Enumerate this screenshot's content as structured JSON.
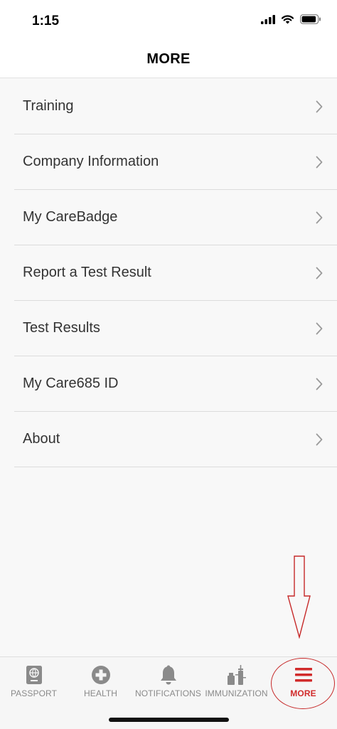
{
  "status_bar": {
    "time": "1:15"
  },
  "header": {
    "title": "MORE"
  },
  "menu": {
    "items": [
      {
        "label": "Training"
      },
      {
        "label": "Company Information"
      },
      {
        "label": "My CareBadge"
      },
      {
        "label": "Report a Test Result"
      },
      {
        "label": "Test Results"
      },
      {
        "label": "My Care685 ID"
      },
      {
        "label": "About"
      }
    ]
  },
  "tabbar": {
    "tabs": [
      {
        "label": "PASSPORT",
        "icon": "passport-icon"
      },
      {
        "label": "HEALTH",
        "icon": "health-plus-icon"
      },
      {
        "label": "NOTIFICATIONS",
        "icon": "bell-icon"
      },
      {
        "label": "IMMUNIZATION",
        "icon": "vaccine-icon"
      },
      {
        "label": "MORE",
        "icon": "hamburger-icon",
        "active": true
      }
    ]
  },
  "colors": {
    "accent": "#d12b2b",
    "inactive_tab": "#8a8a8a",
    "background": "#f8f8f8",
    "annotation": "#c62828"
  }
}
